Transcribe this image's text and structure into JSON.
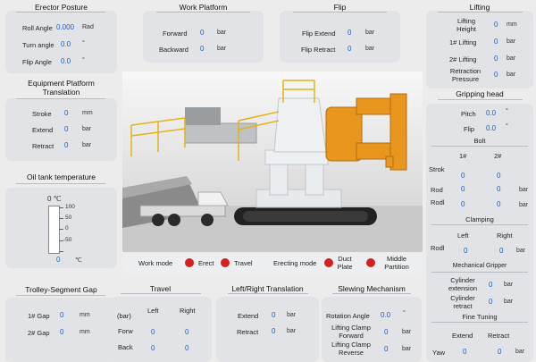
{
  "erector": {
    "title": "Erector Posture",
    "rows": [
      {
        "label": "Roll Angle",
        "value": "0.000",
        "unit": "Rad"
      },
      {
        "label": "Turn angle",
        "value": "0.0",
        "unit": "°"
      },
      {
        "label": "Flip Angle",
        "value": "0.0",
        "unit": "°"
      }
    ]
  },
  "work_platform": {
    "title": "Work Platform",
    "rows": [
      {
        "label": "Forward",
        "value": "0",
        "unit": "bar"
      },
      {
        "label": "Backward",
        "value": "0",
        "unit": "bar"
      }
    ]
  },
  "flip": {
    "title": "Flip",
    "rows": [
      {
        "label": "Flip Extend",
        "value": "0",
        "unit": "bar"
      },
      {
        "label": "Flip Retract",
        "value": "0",
        "unit": "bar"
      }
    ]
  },
  "lifting": {
    "title": "Lifting",
    "rows": [
      {
        "label": "Lifting\nHeight",
        "value": "0",
        "unit": "mm"
      },
      {
        "label": "1# Lifting",
        "value": "0",
        "unit": "bar"
      },
      {
        "label": "2# Lifting",
        "value": "0",
        "unit": "bar"
      },
      {
        "label": "Retraction\nPressure",
        "value": "0",
        "unit": "bar"
      }
    ]
  },
  "equip_platform": {
    "title": "Equipment Platform\nTranslation",
    "rows": [
      {
        "label": "Stroke",
        "value": "0",
        "unit": "mm"
      },
      {
        "label": "Extend",
        "value": "0",
        "unit": "bar"
      },
      {
        "label": "Retract",
        "value": "0",
        "unit": "bar"
      }
    ]
  },
  "oil_tank": {
    "title": "Oil tank temperature",
    "unit_top": "0 ℃",
    "scale": [
      "100",
      "50",
      "0",
      "-50"
    ],
    "value": "0",
    "unit": "℃",
    "level": 0
  },
  "gripping": {
    "title": "Gripping head",
    "pitch": {
      "label": "Pitch",
      "value": "0.0",
      "unit": "°"
    },
    "flip": {
      "label": "Flip",
      "value": "0.0",
      "unit": "°"
    },
    "bolt": {
      "title": "Bolt",
      "col1": "1#",
      "col2": "2#",
      "rows": [
        {
          "label": "Strok",
          "v1": "0",
          "v2": "0",
          "unit": ""
        },
        {
          "label": "Rod",
          "v1": "0",
          "v2": "0",
          "unit": "bar"
        },
        {
          "label": "Rodl",
          "v1": "0",
          "v2": "0",
          "unit": "bar"
        }
      ]
    },
    "clamping": {
      "title": "Clamping",
      "col1": "Left",
      "col2": "Right",
      "row": {
        "label": "Rodl",
        "v1": "0",
        "v2": "0",
        "unit": "bar"
      }
    },
    "mech": {
      "title": "Mechanical Gripper",
      "rows": [
        {
          "label": "Cylinder\nextension",
          "value": "0",
          "unit": "bar"
        },
        {
          "label": "Cylinder\nretract",
          "value": "0",
          "unit": "bar"
        }
      ]
    },
    "fine": {
      "title": "Fine Tuning",
      "col1": "Extend",
      "col2": "Retract",
      "row": {
        "label": "Yaw",
        "v1": "0",
        "v2": "0",
        "unit": "bar"
      }
    }
  },
  "modes": {
    "work_mode": "Work mode",
    "erect": "Erect",
    "travel": "Travel",
    "erecting_mode": "Erecting mode",
    "duct_plate": "Duct\nPlate",
    "middle_partition": "Middle\nPartition",
    "dot_color": "#d32020"
  },
  "trolley": {
    "title": "Trolley-Segment Gap",
    "rows": [
      {
        "label": "1# Gap",
        "value": "0",
        "unit": "mm"
      },
      {
        "label": "2# Gap",
        "value": "0",
        "unit": "mm"
      }
    ]
  },
  "travel": {
    "title": "Travel",
    "unit_label": "(bar)",
    "col1": "Left",
    "col2": "Right",
    "rows": [
      {
        "label": "Forw",
        "v1": "0",
        "v2": "0"
      },
      {
        "label": "Back",
        "v1": "0",
        "v2": "0"
      }
    ]
  },
  "lr_translation": {
    "title": "Left/Right Translation",
    "rows": [
      {
        "label": "Extend",
        "value": "0",
        "unit": "bar"
      },
      {
        "label": "Retract",
        "value": "0",
        "unit": "bar"
      }
    ]
  },
  "slewing": {
    "title": "Slewing Mechanism",
    "rows": [
      {
        "label": "Rotation Angle",
        "value": "0.0",
        "unit": "°"
      },
      {
        "label": "Lifting Clamp\nForward",
        "value": "0",
        "unit": "bar"
      },
      {
        "label": "Lifting Clamp\nReverse",
        "value": "0",
        "unit": "bar"
      }
    ]
  },
  "colors": {
    "value": "#1f5fbf",
    "panel": "#e1e3e6",
    "machine_orange": "#e8961e",
    "machine_white": "#e9ecef",
    "track": "#222222"
  }
}
